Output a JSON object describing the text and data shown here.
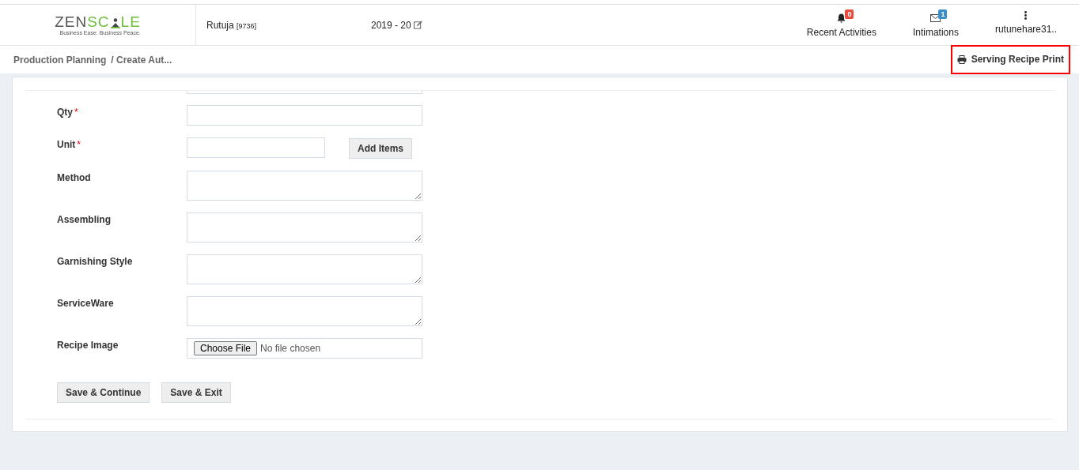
{
  "header": {
    "logo": {
      "prefix": "ZEN",
      "accent": "SC",
      "suffix": "LE",
      "tagline": "Business Ease. Business Peace."
    },
    "user": {
      "name": "Rutuja",
      "code": "[9736]"
    },
    "year": "2019 - 20",
    "actions": [
      {
        "kind": "bell",
        "label": "Recent Activities",
        "badge": "0",
        "color": "#e74c3c"
      },
      {
        "kind": "mail",
        "label": "Intimations",
        "badge": "1",
        "color": "#3a8fc7"
      },
      {
        "kind": "more",
        "label": "rutunehare31.."
      }
    ]
  },
  "breadcrumb": {
    "items": [
      "Production Planning",
      "/ Create Aut..."
    ]
  },
  "print_button": {
    "label": "Serving Recipe Print",
    "highlighted": true
  },
  "form": {
    "required_symbol": "*",
    "fields": [
      {
        "kind": "clipped"
      },
      {
        "kind": "input",
        "label": "Qty",
        "required": true
      },
      {
        "kind": "input-button",
        "label": "Unit",
        "required": true,
        "button": "Add Items"
      },
      {
        "kind": "textarea",
        "label": "Method",
        "required": false
      },
      {
        "kind": "textarea",
        "label": "Assembling",
        "required": false
      },
      {
        "kind": "textarea",
        "label": "Garnishing Style",
        "required": false
      },
      {
        "kind": "textarea",
        "label": "ServiceWare",
        "required": false
      },
      {
        "kind": "file",
        "label": "Recipe Image",
        "required": false,
        "button": "Choose File",
        "status": "No file chosen"
      }
    ],
    "buttons": [
      "Save & Continue",
      "Save & Exit"
    ]
  }
}
